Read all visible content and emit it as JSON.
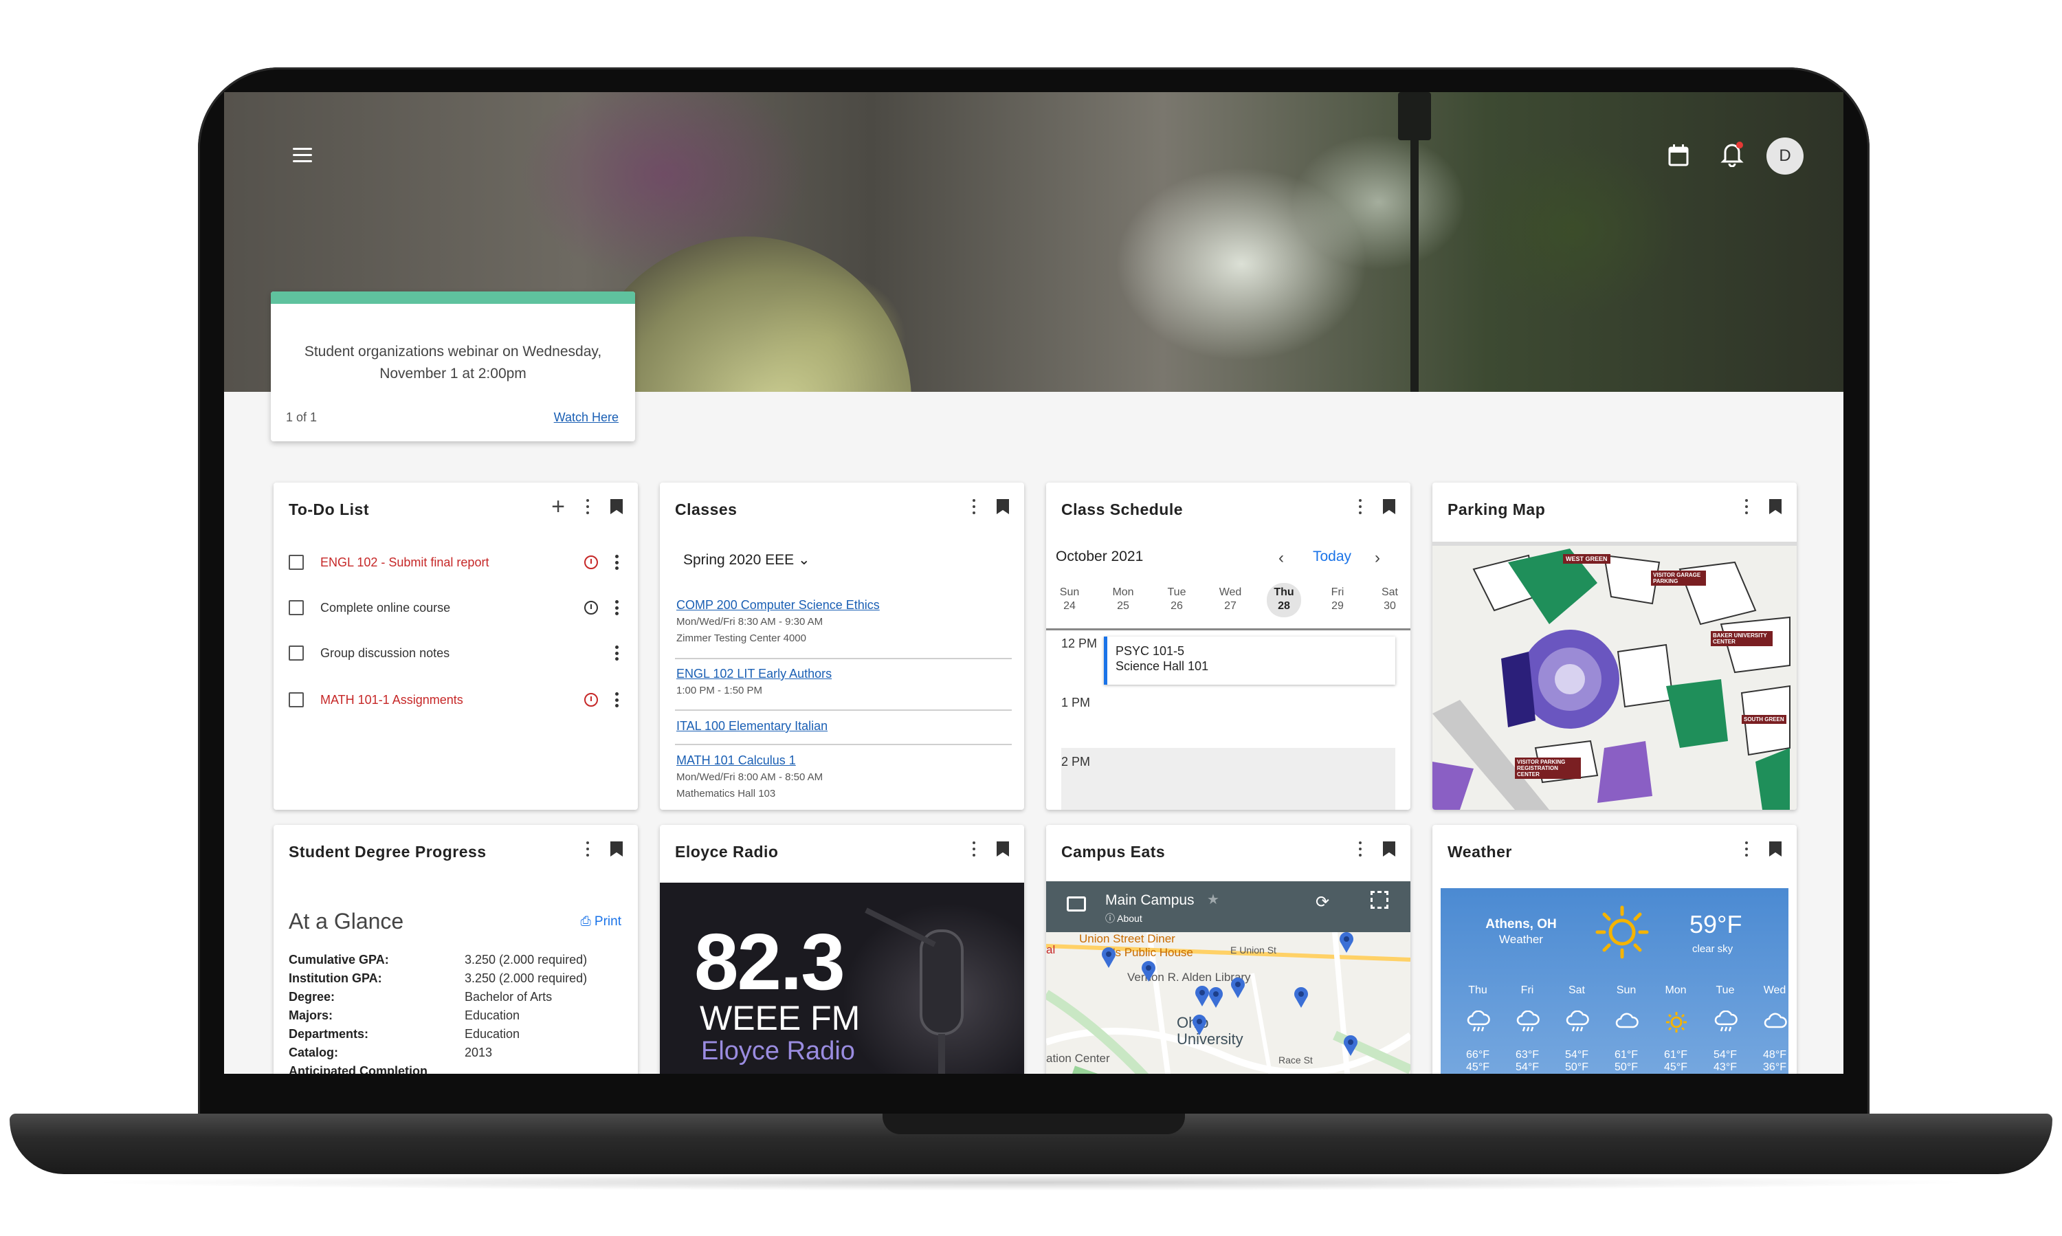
{
  "header": {
    "avatar_initial": "D"
  },
  "announcement": {
    "message": "Student organizations webinar on Wednesday, November 1 at 2:00pm",
    "count": "1 of 1",
    "link": "Watch Here",
    "accent_color": "#5fc29e"
  },
  "todo": {
    "title": "To-Do List",
    "items": [
      {
        "text": "ENGL 102 - Submit final report",
        "overdue": true
      },
      {
        "text": "Complete online course",
        "overdue": false
      },
      {
        "text": "Group discussion notes",
        "overdue": false
      },
      {
        "text": "MATH 101-1 Assignments",
        "overdue": true
      }
    ]
  },
  "classes": {
    "title": "Classes",
    "semester": "Spring 2020 EEE",
    "items": [
      {
        "name": "COMP 200 Computer Science Ethics",
        "meta1": "Mon/Wed/Fri 8:30 AM - 9:30 AM",
        "meta2": "Zimmer Testing Center 4000"
      },
      {
        "name": "ENGL 102 LIT Early Authors",
        "meta1": "1:00 PM - 1:50 PM",
        "meta2": ""
      },
      {
        "name": "ITAL 100 Elementary Italian",
        "meta1": "",
        "meta2": ""
      },
      {
        "name": "MATH 101 Calculus 1",
        "meta1": "Mon/Wed/Fri 8:00 AM - 8:50 AM",
        "meta2": "Mathematics Hall 103"
      }
    ]
  },
  "schedule": {
    "title": "Class Schedule",
    "month": "October 2021",
    "today_label": "Today",
    "days": [
      {
        "name": "Sun",
        "num": "24"
      },
      {
        "name": "Mon",
        "num": "25"
      },
      {
        "name": "Tue",
        "num": "26"
      },
      {
        "name": "Wed",
        "num": "27"
      },
      {
        "name": "Thu",
        "num": "28"
      },
      {
        "name": "Fri",
        "num": "29"
      },
      {
        "name": "Sat",
        "num": "30"
      }
    ],
    "hours": [
      "12 PM",
      "1 PM",
      "2 PM"
    ],
    "event": {
      "title": "PSYC 101-5",
      "location": "Science Hall 101"
    }
  },
  "parking": {
    "title": "Parking Map",
    "labels": [
      "WEST GREEN",
      "VISITOR GARAGE PARKING",
      "BAKER UNIVERSITY CENTER",
      "SOUTH GREEN",
      "VISITOR PARKING REGISTRATION CENTER"
    ]
  },
  "degree": {
    "title": "Student Degree Progress",
    "heading": "At a Glance",
    "print_label": "Print",
    "rows": [
      {
        "k": "Cumulative GPA:",
        "v": "3.250 (2.000 required)"
      },
      {
        "k": "Institution GPA:",
        "v": "3.250 (2.000 required)"
      },
      {
        "k": "Degree:",
        "v": "Bachelor of Arts"
      },
      {
        "k": "Majors:",
        "v": "Education"
      },
      {
        "k": "Departments:",
        "v": "Education"
      },
      {
        "k": "Catalog:",
        "v": "2013"
      },
      {
        "k": "Anticipated Completion",
        "v": ""
      }
    ]
  },
  "radio": {
    "title": "Eloyce Radio",
    "frequency": "82.3",
    "station": "WEEE FM",
    "name": "Eloyce Radio"
  },
  "eats": {
    "title": "Campus Eats",
    "map_title": "Main Campus",
    "about": "About",
    "places": [
      "Union Street Diner",
      "O's Public House",
      "E Union St",
      "Vernon R. Alden Library",
      "Ohio University",
      "ation Center",
      "Race St",
      "al"
    ]
  },
  "weather": {
    "title": "Weather",
    "city": "Athens, OH",
    "sub": "Weather",
    "temp": "59°F",
    "condition": "clear sky",
    "days": [
      {
        "d": "Thu",
        "hi": "66°F",
        "lo": "45°F",
        "icon": "rain-icon"
      },
      {
        "d": "Fri",
        "hi": "63°F",
        "lo": "54°F",
        "icon": "rain-icon"
      },
      {
        "d": "Sat",
        "hi": "54°F",
        "lo": "50°F",
        "icon": "rain-icon"
      },
      {
        "d": "Sun",
        "hi": "61°F",
        "lo": "50°F",
        "icon": "cloud-icon"
      },
      {
        "d": "Mon",
        "hi": "61°F",
        "lo": "45°F",
        "icon": "sun-icon"
      },
      {
        "d": "Tue",
        "hi": "54°F",
        "lo": "43°F",
        "icon": "rain-icon"
      },
      {
        "d": "Wed",
        "hi": "48°F",
        "lo": "36°F",
        "icon": "cloud-icon"
      }
    ]
  }
}
